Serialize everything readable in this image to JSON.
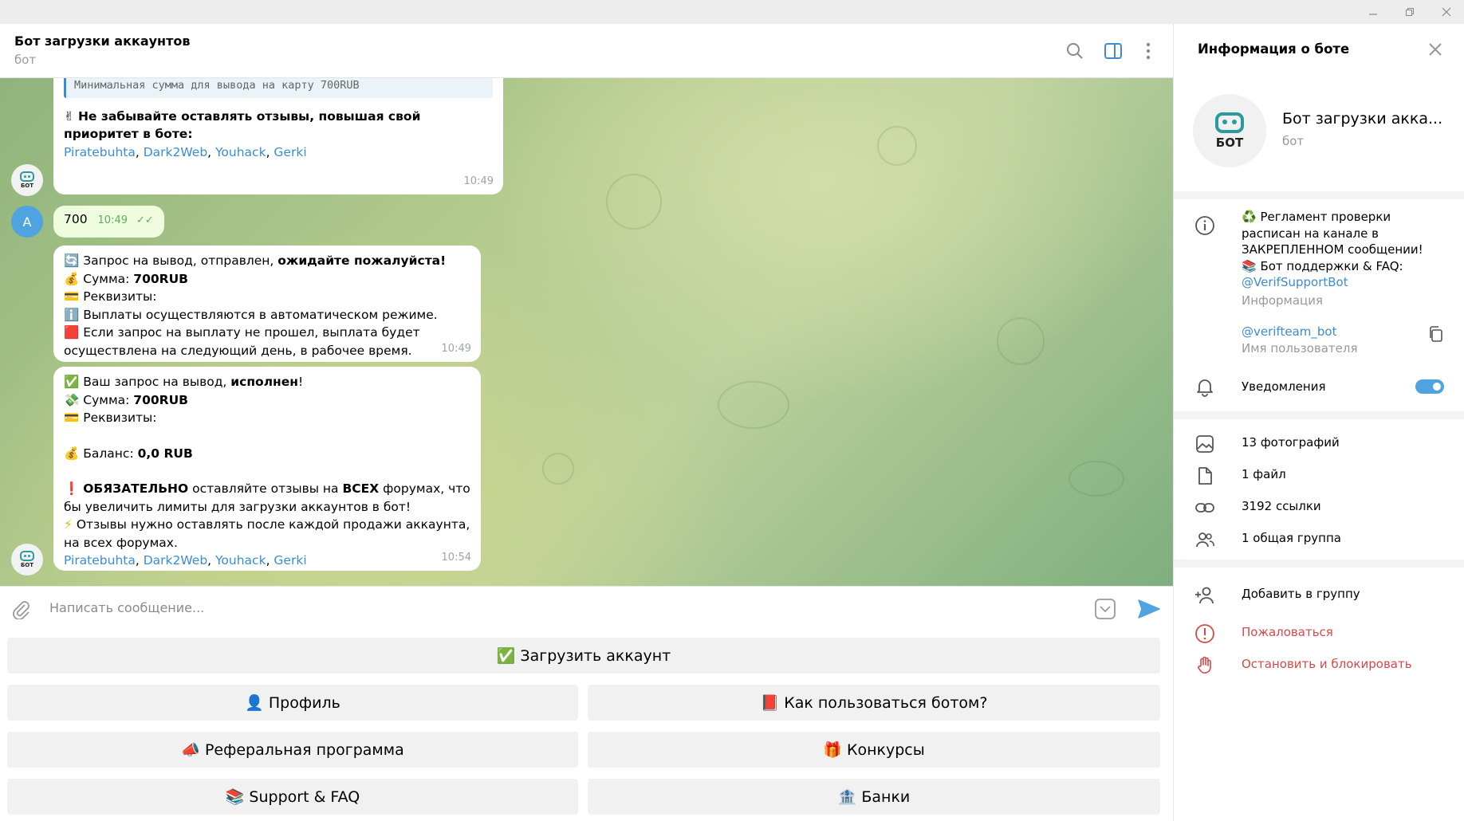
{
  "header": {
    "title": "Бот загрузки аккаунтов",
    "subtitle": "бот"
  },
  "messages": {
    "m1": {
      "quote": "Минимальная сумма для вывода на карту 700RUB",
      "emoji": "✌",
      "text": "Не забывайте оставлять отзывы, повышая свой приоритет в боте:",
      "links": [
        "Piratebuhta",
        "Dark2Web",
        "Youhack",
        "Gerki"
      ],
      "time": "10:49"
    },
    "m2": {
      "text": "700",
      "time": "10:49",
      "check": "✓✓"
    },
    "m3": {
      "l1_emoji": "🔄",
      "l1_a": "Запрос на вывод,  отправлен,",
      "l1_b": "ожидайте пожалуйста!",
      "l2_emoji": "💰",
      "l2_a": "Сумма:",
      "l2_b": "700RUB",
      "l3_emoji": "💳",
      "l3_a": "Реквизиты:",
      "l4_emoji": "ℹ️",
      "l4_a": "Выплаты осуществляются в автоматическом режиме.",
      "l5_emoji": "🟥",
      "l5_a": "Если запрос на выплату не прошел, выплата будет осуществлена на следующий день, в рабочее время.",
      "time": "10:49"
    },
    "m4": {
      "l1_emoji": "✅",
      "l1_a": "Ваш запрос на вывод,",
      "l1_b": "исполнен",
      "l2_emoji": "💸",
      "l2_a": "Сумма:",
      "l2_b": "700RUB",
      "l3_emoji": "💳",
      "l3_a": "Реквизиты:",
      "l4_emoji": "💰",
      "l4_a": "Баланс:",
      "l4_b": "0,0 RUB",
      "l5_emoji": "❗",
      "l5_a": "ОБЯЗАТЕЛЬНО",
      "l5_b": "оставляйте отзывы на",
      "l5_c": "ВСЕХ",
      "l5_d": "форумах, что бы увеличить лимиты для загрузки аккаунтов в бот!",
      "l6_emoji": "⚡",
      "l6_a": "Отзывы нужно оставлять после каждой продажи аккаунта, на всех форумах.",
      "links": [
        "Piratebuhta",
        "Dark2Web",
        "Youhack",
        "Gerki"
      ],
      "time": "10:54"
    }
  },
  "avatar": {
    "bot_label": "БОТ",
    "user_letter": "A"
  },
  "input": {
    "placeholder": "Написать сообщение..."
  },
  "keyboard": {
    "upload": {
      "emoji": "✅",
      "label": "Загрузить аккаунт"
    },
    "profile": {
      "emoji": "👤",
      "label": "Профиль"
    },
    "howto": {
      "emoji": "📕",
      "label": "Как пользоваться ботом?"
    },
    "referral": {
      "emoji": "📣",
      "label": "Реферальная программа"
    },
    "contests": {
      "emoji": "🎁",
      "label": "Конкурсы"
    },
    "support": {
      "emoji": "📚",
      "label": "Support & FAQ"
    },
    "banks": {
      "emoji": "🏦",
      "label": "Банки"
    }
  },
  "side": {
    "title": "Информация о боте",
    "name": "Бот загрузки акка...",
    "name_sub": "бот",
    "info_line1": "♻️ Регламент проверки",
    "info_line2": "расписан на канале в",
    "info_line3": "ЗАКРЕПЛЕННОМ сообщении!",
    "info_line4": "📚 Бот поддержки & FAQ:",
    "info_link": "@VerifSupportBot",
    "info_label": "Информация",
    "username": "@verifteam_bot",
    "username_label": "Имя пользователя",
    "notifications": "Уведомления",
    "photos": "13 фотографий",
    "files": "1 файл",
    "links": "3192 ссылки",
    "groups": "1 общая группа",
    "add_group": "Добавить в группу",
    "report": "Пожаловаться",
    "block": "Остановить и блокировать"
  },
  "colors": {
    "accent": "#3a8dd0",
    "danger": "#d34a4a",
    "out_bubble": "#effdde"
  }
}
